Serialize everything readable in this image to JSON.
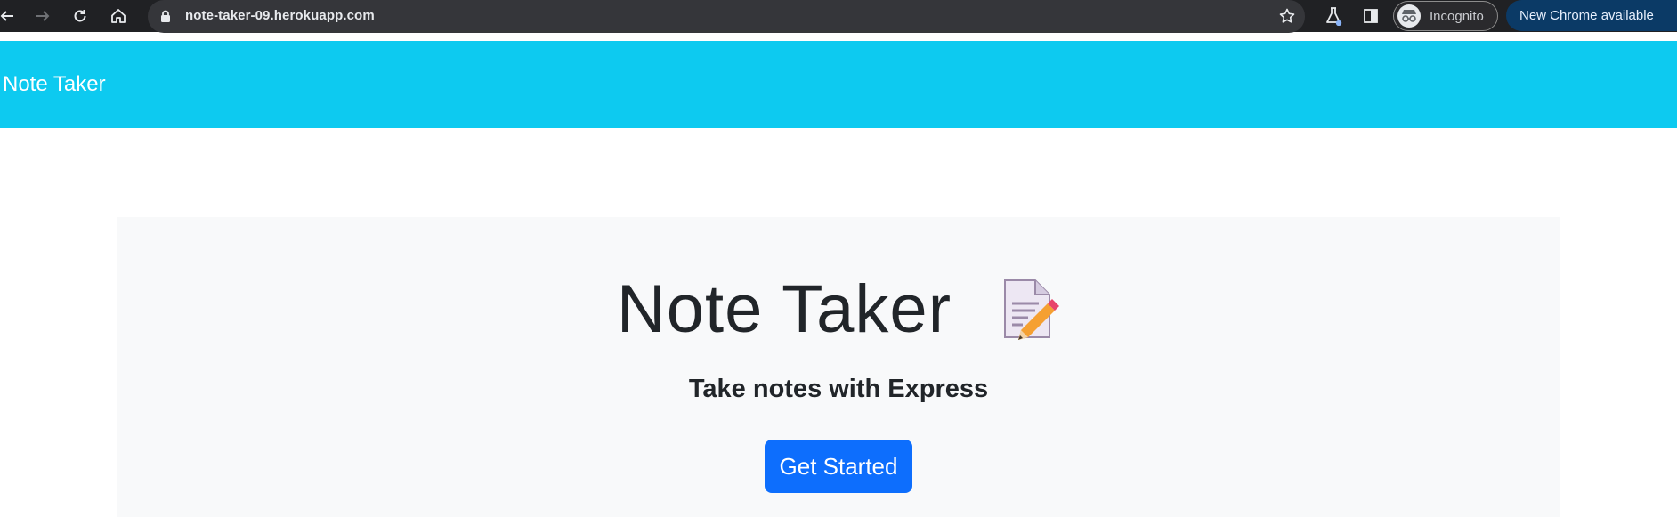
{
  "browser": {
    "url": "note-taker-09.herokuapp.com",
    "incognito_label": "Incognito",
    "update_label": "New Chrome available",
    "icons": [
      "back-arrow-icon",
      "forward-arrow-icon",
      "reload-icon",
      "home-icon",
      "lock-icon",
      "star-icon",
      "labs-flask-icon",
      "side-panel-icon",
      "incognito-icon"
    ]
  },
  "navbar": {
    "brand": "Note Taker",
    "color": "#0dcaf0"
  },
  "hero": {
    "title": "Note Taker",
    "title_icon": "memo-emoji-icon",
    "subtitle": "Take notes with Express",
    "button_label": "Get Started",
    "button_color": "#0d6efd"
  }
}
